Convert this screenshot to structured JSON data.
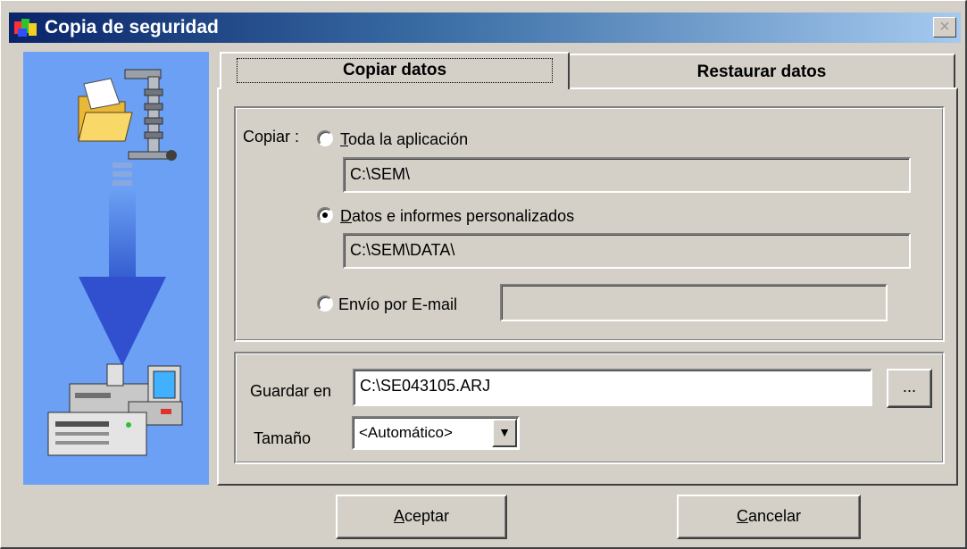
{
  "window": {
    "title": "Copia de seguridad",
    "close_glyph": "×"
  },
  "tabs": [
    {
      "label": "Copiar datos",
      "selected": true
    },
    {
      "label": "Restaurar datos",
      "selected": false
    }
  ],
  "copy_group": {
    "label": "Copiar :",
    "options": [
      {
        "label": "Toda la aplicación",
        "mnemonic": "T",
        "rest": "oda la aplicación",
        "selected": false,
        "path": "C:\\SEM\\"
      },
      {
        "label": "Datos e informes personalizados",
        "mnemonic": "D",
        "rest": "atos e informes personalizados",
        "selected": true,
        "path": "C:\\SEM\\DATA\\"
      },
      {
        "label": "Envío por E-mail",
        "selected": false,
        "path": ""
      }
    ]
  },
  "save_group": {
    "save_label": "Guardar en",
    "save_value": "C:\\SE043105.ARJ",
    "browse_label": "...",
    "size_label": "Tamaño",
    "size_value": "<Automático>"
  },
  "buttons": {
    "accept": {
      "mnemonic": "A",
      "rest": "ceptar"
    },
    "cancel": {
      "mnemonic": "C",
      "rest": "ancelar"
    }
  },
  "icons": {
    "app": "app-icon",
    "clamp": "folder-clamp-icon",
    "arrow": "down-arrow-icon",
    "computers": "computers-icon"
  },
  "colors": {
    "title_start": "#0a246a",
    "title_end": "#a6caf0",
    "side_panel": "#6ba0f4",
    "face": "#d4d0c8"
  }
}
